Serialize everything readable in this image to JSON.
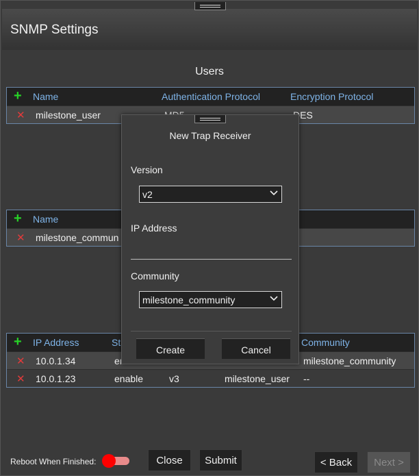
{
  "window": {
    "title": "SNMP Settings"
  },
  "users": {
    "section_title": "Users",
    "headers": [
      "Name",
      "Authentication Protocol",
      "Encryption Protocol"
    ],
    "rows": [
      {
        "name": "milestone_user",
        "auth": "MD5",
        "enc": "DES"
      }
    ]
  },
  "communities": {
    "headers": [
      "Name"
    ],
    "rows": [
      {
        "name": "milestone_commun"
      }
    ]
  },
  "receivers": {
    "headers": [
      "IP Address",
      "Sta",
      "Community"
    ],
    "rows": [
      {
        "ip": "10.0.1.34",
        "status": "en",
        "version": "",
        "user": "",
        "community": "milestone_community"
      },
      {
        "ip": "10.0.1.23",
        "status": "enable",
        "version": "v3",
        "user": "milestone_user",
        "community": "--"
      }
    ]
  },
  "modal": {
    "title": "New Trap Receiver",
    "version_label": "Version",
    "version_value": "v2",
    "ip_label": "IP Address",
    "ip_value": "",
    "community_label": "Community",
    "community_value": "milestone_community",
    "create_label": "Create",
    "cancel_label": "Cancel"
  },
  "footer": {
    "reboot_label": "Reboot When Finished:",
    "close_label": "Close",
    "submit_label": "Submit",
    "back_label": "< Back",
    "next_label": "Next >"
  },
  "colors": {
    "accent_header": "#7fb4e8",
    "add_icon": "#27d327",
    "remove_icon": "#e23b3b",
    "toggle_knob": "#ff0000"
  }
}
